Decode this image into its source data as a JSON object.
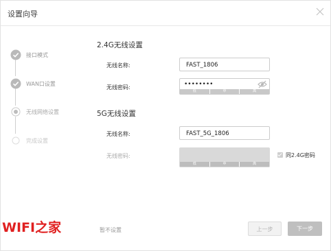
{
  "dialog": {
    "title": "设置向导"
  },
  "steps": [
    {
      "label": "接口模式",
      "state": "done"
    },
    {
      "label": "WAN口设置",
      "state": "done"
    },
    {
      "label": "无线网络设置",
      "state": "current"
    },
    {
      "label": "完成设置",
      "state": "pending"
    }
  ],
  "wifi24": {
    "section_title": "2.4G无线设置",
    "name_label": "无线名称:",
    "name_value": "FAST_1806",
    "password_label": "无线密码:",
    "password_value": "••••••••",
    "strength": [
      "低",
      "中",
      "高"
    ]
  },
  "wifi5": {
    "section_title": "5G无线设置",
    "name_label": "无线名称:",
    "name_value": "FAST_5G_1806",
    "password_label": "无线密码:",
    "strength": [
      "低",
      "中",
      "高"
    ],
    "same_as_24_label": "同2.4G密码",
    "same_as_24_checked": true
  },
  "footer": {
    "skip_label": "暂不设置",
    "prev_label": "上一步",
    "next_label": "下一步"
  },
  "watermark": "WIFI之家",
  "colors": {
    "step_done": "#b9b9b9",
    "accent_red": "#e02020",
    "disabled_button": "#bfbfbf"
  }
}
